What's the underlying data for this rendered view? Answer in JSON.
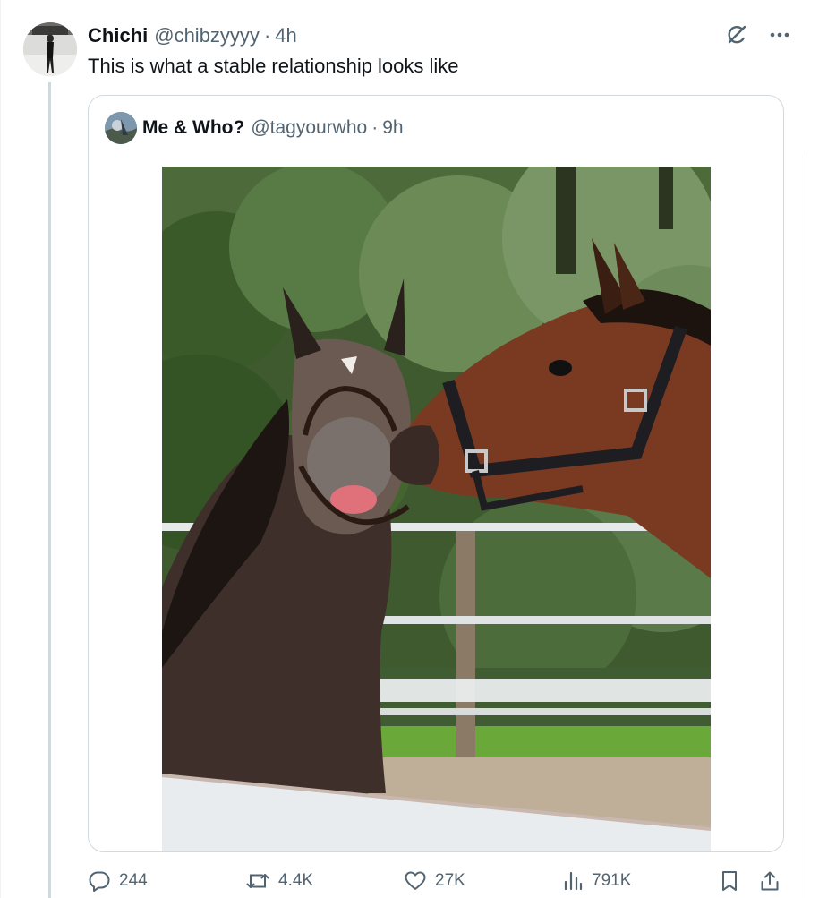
{
  "post": {
    "author_name": "Chichi",
    "author_handle": "@chibzyyyy",
    "separator": "·",
    "time": "4h",
    "text": "This is what a stable relationship looks like",
    "avatar_icon": "user-avatar",
    "top_icons": [
      "grok-icon",
      "more-icon"
    ]
  },
  "quoted": {
    "author_name": "Me & Who?",
    "author_handle": "@tagyourwho",
    "separator": "·",
    "time": "9h",
    "avatar_icon": "user-avatar",
    "media_type": "photo"
  },
  "actions": {
    "replies": "244",
    "reposts": "4.4K",
    "likes": "27K",
    "views": "791K",
    "icons": [
      "reply-icon",
      "repost-icon",
      "like-icon",
      "views-icon",
      "bookmark-icon",
      "share-icon"
    ]
  },
  "colors": {
    "text": "#0f1419",
    "secondary": "#536471",
    "border": "#cfd9de",
    "thread_line": "#cfd9de",
    "background": "#ffffff"
  }
}
